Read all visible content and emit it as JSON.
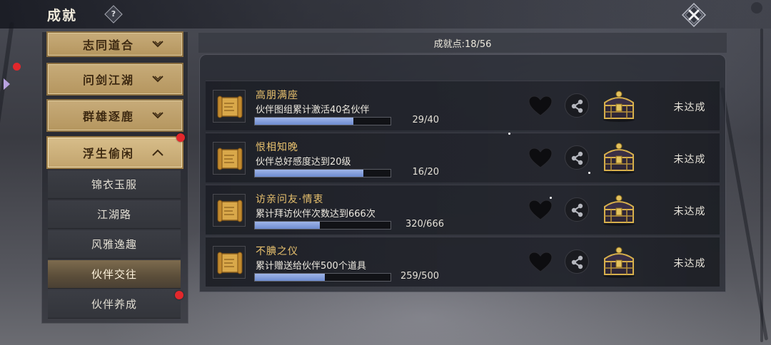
{
  "header": {
    "title": "成就",
    "help_glyph": "?"
  },
  "sidebar": {
    "categories": [
      {
        "label": "志同道合",
        "expanded": false,
        "has_alert": false
      },
      {
        "label": "问剑江湖",
        "expanded": false,
        "has_alert": false
      },
      {
        "label": "群雄逐鹿",
        "expanded": false,
        "has_alert": false
      },
      {
        "label": "浮生偷闲",
        "expanded": true,
        "has_alert": true
      }
    ],
    "subitems": [
      {
        "label": "锦衣玉服",
        "selected": false,
        "has_alert": false
      },
      {
        "label": "江湖路",
        "selected": false,
        "has_alert": false
      },
      {
        "label": "风雅逸趣",
        "selected": false,
        "has_alert": false
      },
      {
        "label": "伙伴交往",
        "selected": true,
        "has_alert": false
      },
      {
        "label": "伙伴养成",
        "selected": false,
        "has_alert": true
      }
    ]
  },
  "main": {
    "points_label": "成就点:18/56",
    "achievements": [
      {
        "name": "高朋满座",
        "desc": "伙伴图组累计激活40名伙伴",
        "current": 29,
        "total": 40,
        "progress_text": "29/40",
        "status": "未达成",
        "icons": [
          "scroll-icon",
          "heart-icon",
          "share-icon",
          "chest-icon"
        ]
      },
      {
        "name": "恨相知晚",
        "desc": "伙伴总好感度达到20级",
        "current": 16,
        "total": 20,
        "progress_text": "16/20",
        "status": "未达成",
        "icons": [
          "scroll-icon",
          "heart-icon",
          "share-icon",
          "chest-icon"
        ]
      },
      {
        "name": "访亲问友·情衷",
        "desc": "累计拜访伙伴次数达到666次",
        "current": 320,
        "total": 666,
        "progress_text": "320/666",
        "status": "未达成",
        "icons": [
          "scroll-icon",
          "heart-icon",
          "share-icon",
          "chest-icon"
        ]
      },
      {
        "name": "不腆之仪",
        "desc": "累计赠送给伙伴500个道具",
        "current": 259,
        "total": 500,
        "progress_text": "259/500",
        "status": "未达成",
        "icons": [
          "scroll-icon",
          "heart-icon",
          "share-icon",
          "chest-icon"
        ]
      }
    ]
  },
  "colors": {
    "accent_gold": "#c7ab79",
    "achievement_name": "#e8c16e",
    "progress_fill": "#6e8cd0",
    "alert_red": "#e3282c"
  }
}
